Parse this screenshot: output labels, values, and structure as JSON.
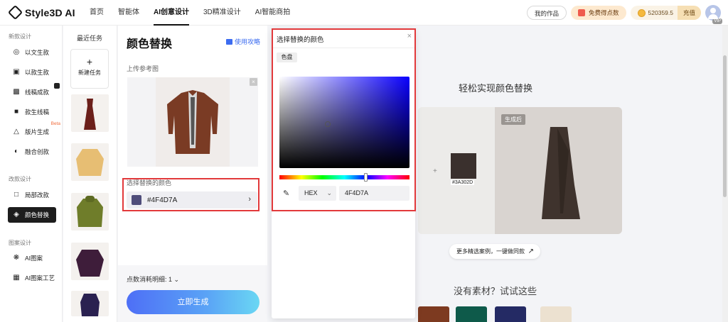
{
  "app": {
    "logo_text": "Style3D AI"
  },
  "nav": {
    "items": [
      "首页",
      "智能体",
      "AI创意设计",
      "3D精准设计",
      "AI智能商拍"
    ],
    "active_index": 2
  },
  "topright": {
    "my_works": "我的作品",
    "free_points": "免费得点数",
    "coins": "520359.5",
    "recharge": "充值",
    "vip": "VIP"
  },
  "sidebar": {
    "section1": "新款设计",
    "items1": [
      "以文生款",
      "以款生款",
      "线稿成款",
      "款生线稿",
      "版片生成",
      "融合创款"
    ],
    "beta_label": "Beta",
    "section2": "改款设计",
    "items2": [
      "局部改款",
      "颜色替换"
    ],
    "section3": "图案设计",
    "items3": [
      "AI图案",
      "AI图案工艺"
    ]
  },
  "tasks": {
    "title": "最近任务",
    "new_task": "新建任务"
  },
  "form": {
    "title": "颜色替换",
    "guide_label": "使用攻略",
    "upload_label": "上传参考图",
    "color_label": "选择替换的颜色",
    "color_value": "#4F4D7A",
    "swatch_color": "#4F4D7A",
    "cost_label": "点数消耗明细: 1",
    "generate_label": "立即生成"
  },
  "preview": {
    "heading": "轻松实现颜色替换",
    "generated_tag": "生成后",
    "sample_color_label": "#3A302D",
    "sample_color": "#3A302D",
    "more_cases": "更多精选案例，一键做同款",
    "no_material": "没有素材？试试这些"
  },
  "picker": {
    "title": "选择替换的颜色",
    "tab_label": "色盘",
    "format": "HEX",
    "hex_value": "4F4D7A"
  }
}
